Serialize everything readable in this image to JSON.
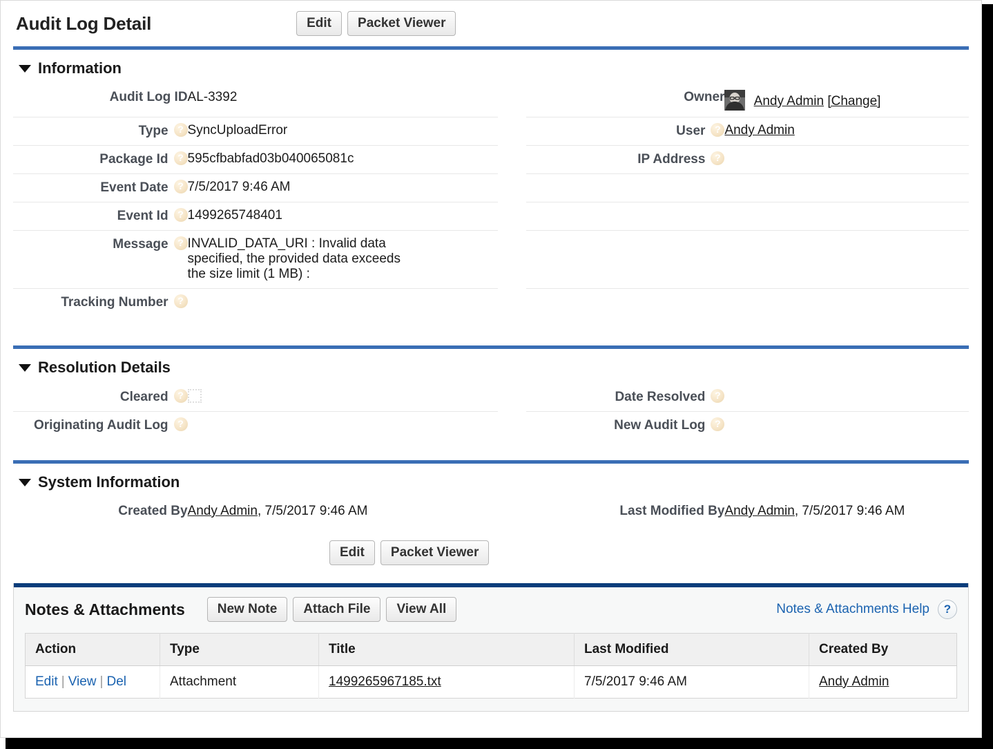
{
  "header": {
    "title": "Audit Log Detail",
    "buttons": [
      {
        "label": "Edit",
        "name": "edit-button"
      },
      {
        "label": "Packet Viewer",
        "name": "packet-viewer-button"
      }
    ]
  },
  "sections": {
    "information": {
      "title": "Information",
      "left_fields": [
        {
          "label": "Audit Log ID",
          "value": "AL-3392",
          "help": false
        },
        {
          "label": "Type",
          "value": "SyncUploadError",
          "help": true
        },
        {
          "label": "Package Id",
          "value": "595cfbabfad03b040065081c",
          "help": true
        },
        {
          "label": "Event Date",
          "value": "7/5/2017 9:46 AM",
          "help": true
        },
        {
          "label": "Event Id",
          "value": "1499265748401",
          "help": true
        }
      ],
      "message": {
        "label": "Message",
        "lines": [
          "INVALID_DATA_URI : Invalid data",
          "specified, the provided data exceeds",
          "the size limit (1 MB) :"
        ]
      },
      "tracking_number": {
        "label": "Tracking Number",
        "value": ""
      },
      "owner": {
        "label": "Owner",
        "name": "Andy Admin",
        "change_label": "[Change]"
      },
      "user": {
        "label": "User",
        "value": "Andy Admin"
      },
      "ip_address": {
        "label": "IP Address",
        "value": ""
      }
    },
    "resolution": {
      "title": "Resolution Details",
      "cleared": {
        "label": "Cleared",
        "checked": false
      },
      "date_resolved": {
        "label": "Date Resolved",
        "value": ""
      },
      "originating_audit_log": {
        "label": "Originating Audit Log",
        "value": ""
      },
      "new_audit_log": {
        "label": "New Audit Log",
        "value": ""
      }
    },
    "system": {
      "title": "System Information",
      "created_by": {
        "label": "Created By",
        "user": "Andy Admin",
        "timestamp": ", 7/5/2017 9:46 AM"
      },
      "last_modified_by": {
        "label": "Last Modified By",
        "user": "Andy Admin",
        "timestamp": ", 7/5/2017 9:46 AM"
      },
      "buttons": [
        {
          "label": "Edit"
        },
        {
          "label": "Packet Viewer"
        }
      ]
    }
  },
  "notes_attachments": {
    "title": "Notes & Attachments",
    "buttons": [
      {
        "label": "New Note"
      },
      {
        "label": "Attach File"
      },
      {
        "label": "View All"
      }
    ],
    "help_link": "Notes & Attachments Help",
    "columns": [
      "Action",
      "Type",
      "Title",
      "Last Modified",
      "Created By"
    ],
    "rows": [
      {
        "actions": [
          "Edit",
          "View",
          "Del"
        ],
        "type": "Attachment",
        "title": "1499265967185.txt",
        "last_modified": "7/5/2017 9:46 AM",
        "created_by": "Andy Admin"
      }
    ]
  },
  "colors": {
    "section_rule": "#3a6eb5",
    "panel_rule": "#0b3d7b",
    "link_blue": "#1b63b0",
    "label_gray": "#4a4f57"
  }
}
